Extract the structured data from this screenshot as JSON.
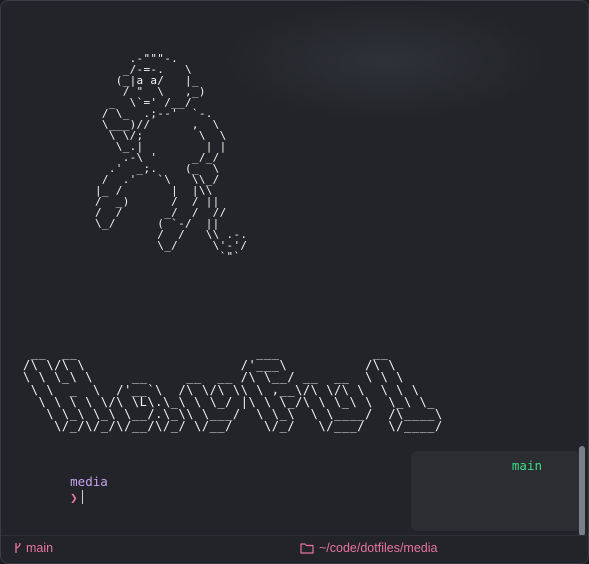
{
  "terminal": {
    "ascii_figure": "     .-\"\"\"-.\n    _/-=-.   \\\n   (_|a a/   |_\n    / \"  \\   ,_)\n  _  \\`=' /__/\n / \\_  .;--'  `-.\n \\___)//      ,  \\\n  \\ \\/;        \\  \\\n   \\_.|         | |\n    .-\\ '     _/_/\n  .'  _;.    (_  \\\n /  .'   `\\   \\\\_/\n|_ /       |  |\\\\\n/  _)      /  / ||\n/  /      _/  /  //\n\\_/      ( `-/  ||\n         /  /   \\\\ .-.\n         \\_/     \\'-'/\n                  `\"`",
    "ascii_banner": " __  __                       ___            __  \n/\\ \\/\\ \\                    /'___\\          /\\ \\ \n\\ \\ \\_\\ \\     __     __  __ /\\ \\__/ __  __  \\ \\ \\\n \\ \\  _  \\  /'__`\\  /\\ \\/\\ \\\\ \\ ,__\\/\\ \\/\\ \\  \\ \\ \\\n  \\ \\ \\ \\ \\/\\ \\L\\.\\_\\ \\ \\_/ |\\ \\ \\_/\\ \\ \\_\\ \\  \\_\\ \\_\n   \\ \\_\\ \\_\\ \\__/.\\_\\\\ \\___/  \\ \\_\\  \\ \\____/  /\\____\\\n    \\/_/\\/_/\\/__/\\/_/ \\/__/    \\/_/   \\/___/   \\/____/",
    "prompt_dir": "media",
    "prompt_arrow": "❯",
    "right_branch": "main"
  },
  "statusbar": {
    "branch_icon": "git-branch-icon",
    "branch": "main",
    "folder_icon": "folder-icon",
    "path": "~/code/dotfiles/media"
  },
  "colors": {
    "background": "#222429",
    "prompt_dir": "#c7a0f0",
    "prompt_arrow": "#e87aa0",
    "right_branch": "#3ddc84",
    "status_text": "#e9739c"
  }
}
